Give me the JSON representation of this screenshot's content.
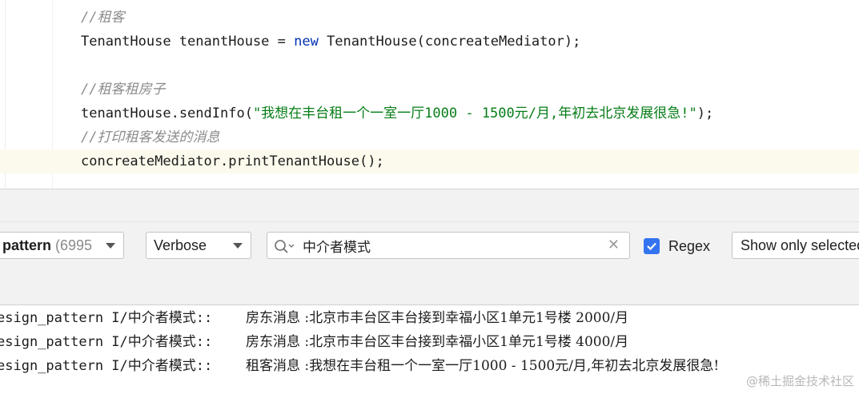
{
  "editor": {
    "lines": [
      {
        "type": "comment",
        "text": "//租客"
      },
      {
        "type": "code",
        "parts": [
          {
            "cls": "plain",
            "text": "TenantHouse tenantHouse = "
          },
          {
            "cls": "kw",
            "text": "new"
          },
          {
            "cls": "plain",
            "text": " TenantHouse(concreateMediator);"
          }
        ]
      },
      {
        "type": "blank",
        "text": ""
      },
      {
        "type": "comment",
        "text": "//租客租房子"
      },
      {
        "type": "code",
        "parts": [
          {
            "cls": "plain",
            "text": "tenantHouse.sendInfo("
          },
          {
            "cls": "str",
            "text": "\"我想在丰台租一个一室一厅1000 - 1500元/月,年初去北京发展很急!\""
          },
          {
            "cls": "plain",
            "text": ");"
          }
        ]
      },
      {
        "type": "comment",
        "text": "//打印租客发送的消息"
      },
      {
        "type": "code",
        "current": true,
        "parts": [
          {
            "cls": "plain",
            "text": "concreateMediator.printTenantHouse();"
          }
        ]
      }
    ],
    "closing_brace": "}"
  },
  "logcat": {
    "process": {
      "name": "pattern",
      "pid": "(6995"
    },
    "level": "Verbose",
    "search": {
      "value": "中介者模式",
      "clear_glyph": "✕"
    },
    "regex": {
      "label": "Regex",
      "checked": true
    },
    "filter": "Show only selected"
  },
  "log_lines": [
    {
      "tag": "esign_pattern I/中介者模式::",
      "message": "房东消息 :北京市丰台区丰台接到幸福小区1单元1号楼 2000/月"
    },
    {
      "tag": "esign_pattern I/中介者模式::",
      "message": "房东消息 :北京市丰台区丰台接到幸福小区1单元1号楼 4000/月"
    },
    {
      "tag": "esign_pattern I/中介者模式::",
      "message": "租客消息 :我想在丰台租一个一室一厅1000 - 1500元/月,年初去北京发展很急!"
    }
  ],
  "watermark": "@稀土掘金技术社区",
  "colors": {
    "accent": "#3574f0",
    "string": "#067d17",
    "keyword": "#0033b3",
    "comment": "#8c8c8c"
  },
  "icons": {
    "search": "search-icon",
    "clear": "clear-icon",
    "caret": "chevron-down-icon"
  }
}
